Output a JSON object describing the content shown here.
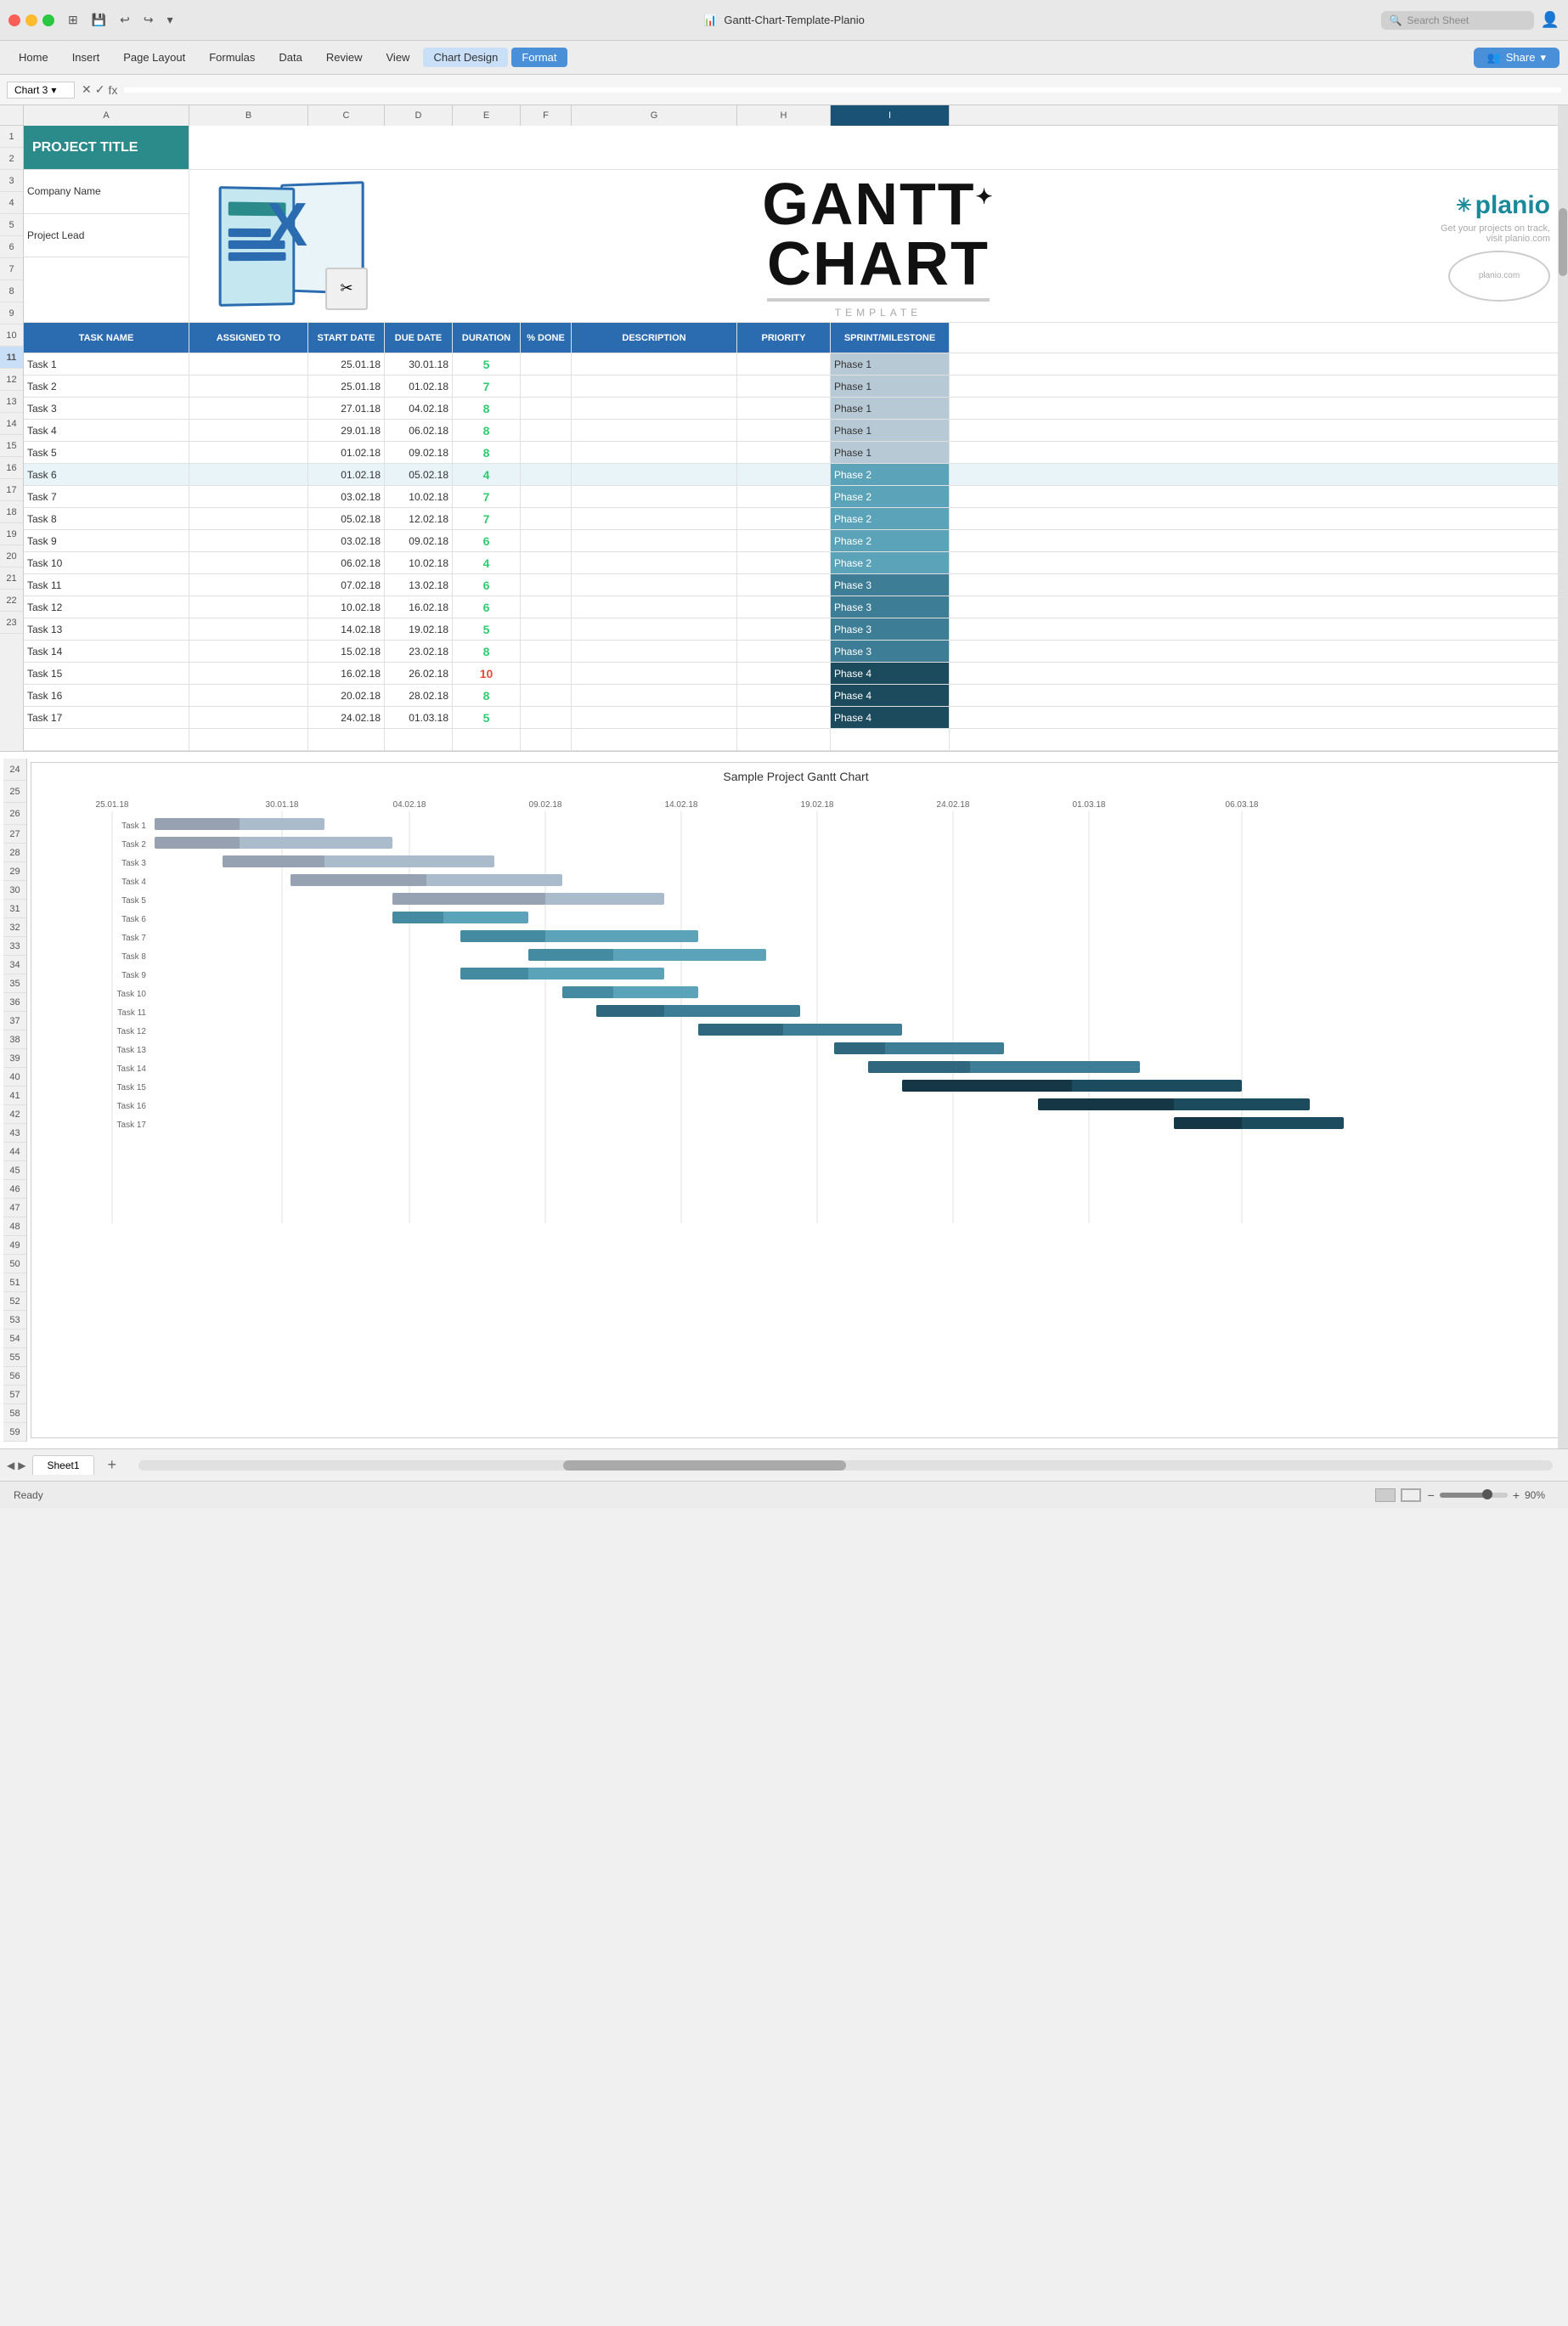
{
  "titleBar": {
    "appName": "Gantt-Chart-Template-Planio",
    "searchPlaceholder": "Search Sheet",
    "userIcon": "👤"
  },
  "menuBar": {
    "items": [
      "Home",
      "Insert",
      "Page Layout",
      "Formulas",
      "Data",
      "Review",
      "View",
      "Chart Design",
      "Format"
    ],
    "activeItem": "Chart Design",
    "shareLabel": "Share"
  },
  "formulaBar": {
    "cellRef": "Chart 3",
    "formula": ""
  },
  "spreadsheet": {
    "columns": [
      "A",
      "B",
      "C",
      "D",
      "E",
      "F",
      "G",
      "H",
      "I"
    ],
    "rows": {
      "row1": {
        "a": "PROJECT TITLE"
      },
      "row2": {
        "a": "Company Name"
      },
      "row3": {
        "a": "Project Lead"
      },
      "row5": {
        "headers": [
          "TASK NAME",
          "ASSIGNED TO",
          "START DATE",
          "DUE DATE",
          "DURATION",
          "% DONE",
          "DESCRIPTION",
          "PRIORITY",
          "SPRINT/MILESTONE"
        ]
      },
      "tasks": [
        {
          "num": 6,
          "name": "Task 1",
          "start": "25.01.18",
          "due": "30.01.18",
          "duration": "5",
          "phase": "Phase 1"
        },
        {
          "num": 7,
          "name": "Task 2",
          "start": "25.01.18",
          "due": "01.02.18",
          "duration": "7",
          "phase": "Phase 1"
        },
        {
          "num": 8,
          "name": "Task 3",
          "start": "27.01.18",
          "due": "04.02.18",
          "duration": "8",
          "phase": "Phase 1"
        },
        {
          "num": 9,
          "name": "Task 4",
          "start": "29.01.18",
          "due": "06.02.18",
          "duration": "8",
          "phase": "Phase 1"
        },
        {
          "num": 10,
          "name": "Task 5",
          "start": "01.02.18",
          "due": "09.02.18",
          "duration": "8",
          "phase": "Phase 1"
        },
        {
          "num": 11,
          "name": "Task 6",
          "start": "01.02.18",
          "due": "05.02.18",
          "duration": "4",
          "phase": "Phase 2"
        },
        {
          "num": 12,
          "name": "Task 7",
          "start": "03.02.18",
          "due": "10.02.18",
          "duration": "7",
          "phase": "Phase 2"
        },
        {
          "num": 13,
          "name": "Task 8",
          "start": "05.02.18",
          "due": "12.02.18",
          "duration": "7",
          "phase": "Phase 2"
        },
        {
          "num": 14,
          "name": "Task 9",
          "start": "03.02.18",
          "due": "09.02.18",
          "duration": "6",
          "phase": "Phase 2"
        },
        {
          "num": 15,
          "name": "Task 10",
          "start": "06.02.18",
          "due": "10.02.18",
          "duration": "4",
          "phase": "Phase 2"
        },
        {
          "num": 16,
          "name": "Task 11",
          "start": "07.02.18",
          "due": "13.02.18",
          "duration": "6",
          "phase": "Phase 3"
        },
        {
          "num": 17,
          "name": "Task 12",
          "start": "10.02.18",
          "due": "16.02.18",
          "duration": "6",
          "phase": "Phase 3"
        },
        {
          "num": 18,
          "name": "Task 13",
          "start": "14.02.18",
          "due": "19.02.18",
          "duration": "5",
          "phase": "Phase 3"
        },
        {
          "num": 19,
          "name": "Task 14",
          "start": "15.02.18",
          "due": "23.02.18",
          "duration": "8",
          "phase": "Phase 3"
        },
        {
          "num": 20,
          "name": "Task 15",
          "start": "16.02.18",
          "due": "26.02.18",
          "duration": "10",
          "phase": "Phase 4"
        },
        {
          "num": 21,
          "name": "Task 16",
          "start": "20.02.18",
          "due": "28.02.18",
          "duration": "8",
          "phase": "Phase 4"
        },
        {
          "num": 22,
          "name": "Task 17",
          "start": "24.02.18",
          "due": "01.03.18",
          "duration": "5",
          "phase": "Phase 4"
        }
      ]
    }
  },
  "chart": {
    "title": "Sample Project Gantt Chart",
    "axisLabels": [
      "25.01.18",
      "30.01.18",
      "04.02.18",
      "09.02.18",
      "14.02.18",
      "19.02.18",
      "24.02.18",
      "01.03.18",
      "06.03.18"
    ],
    "tasks": [
      {
        "label": "Task 1",
        "start": 0,
        "len": 5,
        "phase": 1
      },
      {
        "label": "Task 2",
        "start": 0,
        "len": 7,
        "phase": 1
      },
      {
        "label": "Task 3",
        "start": 2,
        "len": 8,
        "phase": 1
      },
      {
        "label": "Task 4",
        "start": 4,
        "len": 8,
        "phase": 1
      },
      {
        "label": "Task 5",
        "start": 7,
        "len": 8,
        "phase": 1
      },
      {
        "label": "Task 6",
        "start": 7,
        "len": 4,
        "phase": 2
      },
      {
        "label": "Task 7",
        "start": 9,
        "len": 7,
        "phase": 2
      },
      {
        "label": "Task 8",
        "start": 11,
        "len": 7,
        "phase": 2
      },
      {
        "label": "Task 9",
        "start": 9,
        "len": 6,
        "phase": 2
      },
      {
        "label": "Task 10",
        "start": 12,
        "len": 4,
        "phase": 2
      },
      {
        "label": "Task 11",
        "start": 13,
        "len": 6,
        "phase": 3
      },
      {
        "label": "Task 12",
        "start": 16,
        "len": 6,
        "phase": 3
      },
      {
        "label": "Task 13",
        "start": 20,
        "len": 5,
        "phase": 3
      },
      {
        "label": "Task 14",
        "start": 21,
        "len": 8,
        "phase": 3
      },
      {
        "label": "Task 15",
        "start": 22,
        "len": 10,
        "phase": 4
      },
      {
        "label": "Task 16",
        "start": 26,
        "len": 8,
        "phase": 4
      },
      {
        "label": "Task 17",
        "start": 30,
        "len": 5,
        "phase": 4
      }
    ],
    "totalDays": 40
  },
  "statusBar": {
    "status": "Ready",
    "zoom": "90%"
  },
  "sheets": [
    "Sheet1"
  ],
  "planio": {
    "name": "planio",
    "tagline": "Get your projects on track,",
    "tagline2": "visit planio.com"
  }
}
